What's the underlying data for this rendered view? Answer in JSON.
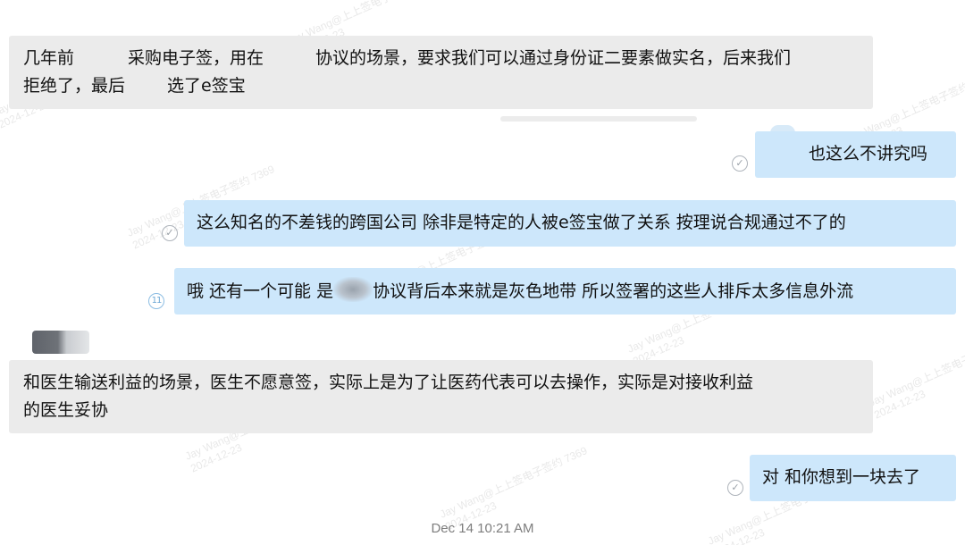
{
  "messages": [
    {
      "id": "m1",
      "direction": "incoming",
      "lines": [
        [
          "几年前",
          "",
          "采购电子签，用在",
          "",
          "协议的场景，要求我们可以通过身份证二要素做实名，后来我们"
        ],
        [
          "拒绝了，最后",
          "",
          "选了e签宝"
        ]
      ]
    },
    {
      "id": "m2",
      "direction": "outgoing",
      "status": "read",
      "text": "也这么不讲究吗"
    },
    {
      "id": "m3",
      "direction": "outgoing",
      "status": "read",
      "text": "这么知名的不差钱的跨国公司 除非是特定的人被e签宝做了关系 按理说合规通过不了的"
    },
    {
      "id": "m4",
      "direction": "outgoing",
      "status": "11",
      "text_before": "哦 还有一个可能 是",
      "text_after": "协议背后本来就是灰色地带 所以签署的这些人排斥太多信息外流"
    },
    {
      "id": "m5",
      "direction": "incoming",
      "lines": [
        [
          "和医生输送利益的场景，医生不愿意签，实际上是为了让医药代表可以去操作，实际是对接收利益"
        ],
        [
          "的医生妥协"
        ]
      ]
    },
    {
      "id": "m6",
      "direction": "outgoing",
      "status": "read",
      "text": "对 和你想到一块去了"
    }
  ],
  "timestamp": "Dec 14 10:21 AM",
  "watermark": {
    "name": "Jay Wang@上上签电子签约 7369",
    "date": "2024-12-23"
  },
  "colors": {
    "incoming_bubble": "#ebebeb",
    "outgoing_bubble": "#cde7fb",
    "status_unread_number": "#6fa9d6"
  },
  "icons": {
    "read_status": "check-circle-icon",
    "unread_count": "number-circle-icon"
  }
}
